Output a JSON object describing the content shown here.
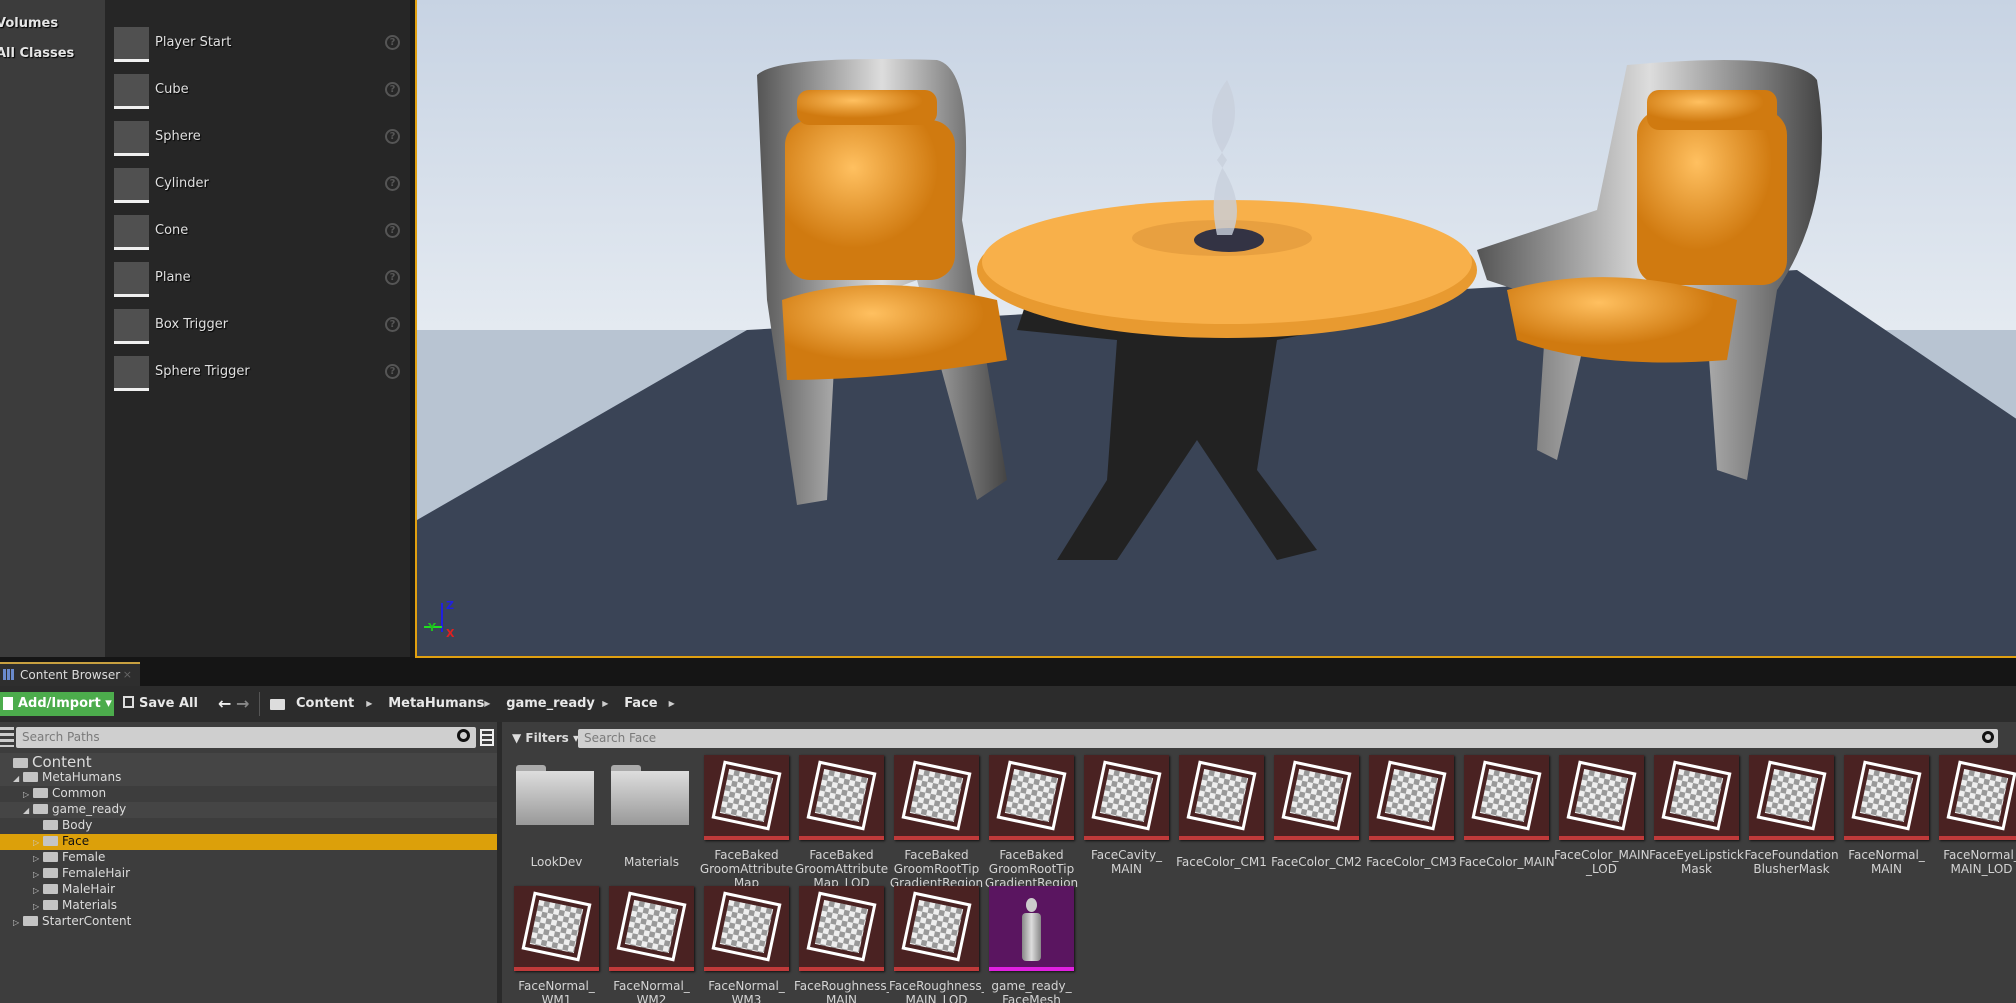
{
  "categories": [
    "Volumes",
    "All Classes"
  ],
  "place_items": [
    {
      "label": "Player Start",
      "icon": "player-start-icon"
    },
    {
      "label": "Cube",
      "icon": "cube-icon"
    },
    {
      "label": "Sphere",
      "icon": "sphere-icon"
    },
    {
      "label": "Cylinder",
      "icon": "cylinder-icon"
    },
    {
      "label": "Cone",
      "icon": "cone-icon"
    },
    {
      "label": "Plane",
      "icon": "plane-icon"
    },
    {
      "label": "Box Trigger",
      "icon": "box-trigger-icon"
    },
    {
      "label": "Sphere Trigger",
      "icon": "sphere-trigger-icon"
    }
  ],
  "help_glyph": "?",
  "viewport": {
    "axis": {
      "z": "Z",
      "y": "Y",
      "x": "X"
    },
    "border_color": "#e0a010"
  },
  "content_browser": {
    "tab_label": "Content Browser",
    "close": "×",
    "add_import": "Add/Import ▾",
    "save_all": "Save All",
    "breadcrumbs": [
      "Content",
      "MetaHumans",
      "game_ready",
      "Face"
    ],
    "search_paths_placeholder": "Search Paths",
    "filters": "Filters ▾",
    "search_assets_placeholder": "Search Face",
    "tree": [
      {
        "label": "Content",
        "depth": 0,
        "arrow": "",
        "open": true
      },
      {
        "label": "MetaHumans",
        "depth": 1,
        "arrow": "◢",
        "open": true
      },
      {
        "label": "Common",
        "depth": 2,
        "arrow": "▷"
      },
      {
        "label": "game_ready",
        "depth": 2,
        "arrow": "◢",
        "open": true
      },
      {
        "label": "Body",
        "depth": 3,
        "arrow": ""
      },
      {
        "label": "Face",
        "depth": 3,
        "arrow": "▷",
        "selected": true
      },
      {
        "label": "Female",
        "depth": 3,
        "arrow": "▷"
      },
      {
        "label": "FemaleHair",
        "depth": 3,
        "arrow": "▷"
      },
      {
        "label": "MaleHair",
        "depth": 3,
        "arrow": "▷"
      },
      {
        "label": "Materials",
        "depth": 3,
        "arrow": "▷"
      },
      {
        "label": "StarterContent",
        "depth": 1,
        "arrow": "▷"
      }
    ],
    "assets": [
      {
        "label": "LookDev",
        "type": "folder"
      },
      {
        "label": "Materials",
        "type": "folder"
      },
      {
        "label": "FaceBaked\nGroomAttribute\nMap",
        "type": "texture"
      },
      {
        "label": "FaceBaked\nGroomAttribute\nMap_LOD",
        "type": "texture"
      },
      {
        "label": "FaceBaked\nGroomRootTip\nGradientRegion",
        "type": "texture"
      },
      {
        "label": "FaceBaked\nGroomRootTip\nGradientRegion",
        "type": "texture"
      },
      {
        "label": "FaceCavity_\nMAIN",
        "type": "texture"
      },
      {
        "label": "FaceColor_CM1",
        "type": "texture"
      },
      {
        "label": "FaceColor_CM2",
        "type": "texture"
      },
      {
        "label": "FaceColor_CM3",
        "type": "texture"
      },
      {
        "label": "FaceColor_MAIN",
        "type": "texture"
      },
      {
        "label": "FaceColor_MAIN\n_LOD",
        "type": "texture"
      },
      {
        "label": "FaceEyeLipstick\nMask",
        "type": "texture"
      },
      {
        "label": "FaceFoundation\nBlusherMask",
        "type": "texture"
      },
      {
        "label": "FaceNormal_\nMAIN",
        "type": "texture"
      },
      {
        "label": "FaceNormal_\nMAIN_LOD",
        "type": "texture"
      },
      {
        "label": "FaceNormal_\nWM1",
        "type": "texture"
      },
      {
        "label": "FaceNormal_\nWM2",
        "type": "texture"
      },
      {
        "label": "FaceNormal_\nWM3",
        "type": "texture"
      },
      {
        "label": "FaceRoughness_\nMAIN",
        "type": "texture"
      },
      {
        "label": "FaceRoughness_\nMAIN_LOD",
        "type": "texture"
      },
      {
        "label": "game_ready_\nFaceMesh",
        "type": "skeletal-mesh"
      }
    ],
    "colors": {
      "add_button": "#4cac4c",
      "selected": "#dca00a",
      "texture_bar": "#c03a3a",
      "mesh_bar": "#e020e0"
    }
  }
}
